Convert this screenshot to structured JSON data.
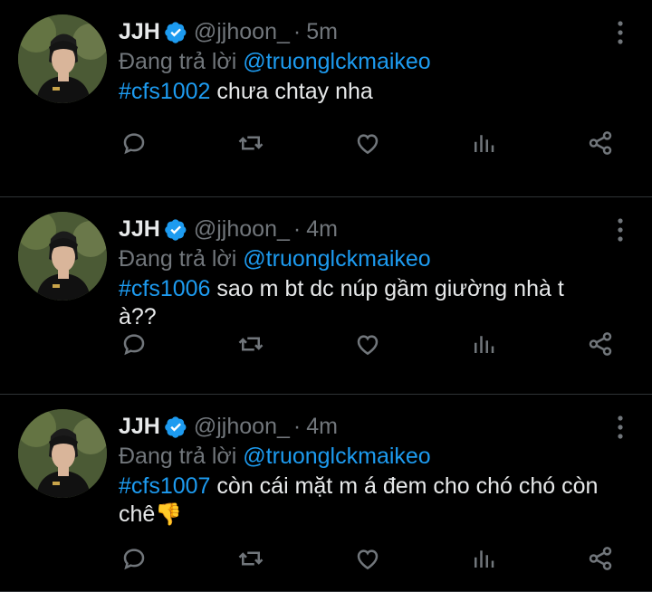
{
  "tweets": [
    {
      "name": "JJH",
      "handle": "@jjhoon_",
      "separator": "·",
      "time": "5m",
      "reply_prefix": "Đang trả lời",
      "reply_to": "@truonglckmaikeo",
      "hashtag": "#cfs1002",
      "text": " chưa chtay nha",
      "emoji": ""
    },
    {
      "name": "JJH",
      "handle": "@jjhoon_",
      "separator": "·",
      "time": "4m",
      "reply_prefix": "Đang trả lời",
      "reply_to": "@truonglckmaikeo",
      "hashtag": "#cfs1006",
      "text": " sao m bt dc núp gầm giường nhà t à??",
      "emoji": ""
    },
    {
      "name": "JJH",
      "handle": "@jjhoon_",
      "separator": "·",
      "time": "4m",
      "reply_prefix": "Đang trả lời",
      "reply_to": "@truonglckmaikeo",
      "hashtag": "#cfs1007",
      "text": " còn cái mặt m á đem cho chó chó còn chê",
      "emoji": "👎"
    }
  ],
  "colors": {
    "background": "#000000",
    "text": "#e7e9ea",
    "muted": "#71767b",
    "link": "#1d9bf0",
    "verified": "#1d9bf0",
    "divider": "#2f3336"
  },
  "icons": [
    "verified-badge-icon",
    "more-vertical-icon",
    "reply-icon",
    "retweet-icon",
    "like-icon",
    "analytics-icon",
    "share-icon"
  ]
}
